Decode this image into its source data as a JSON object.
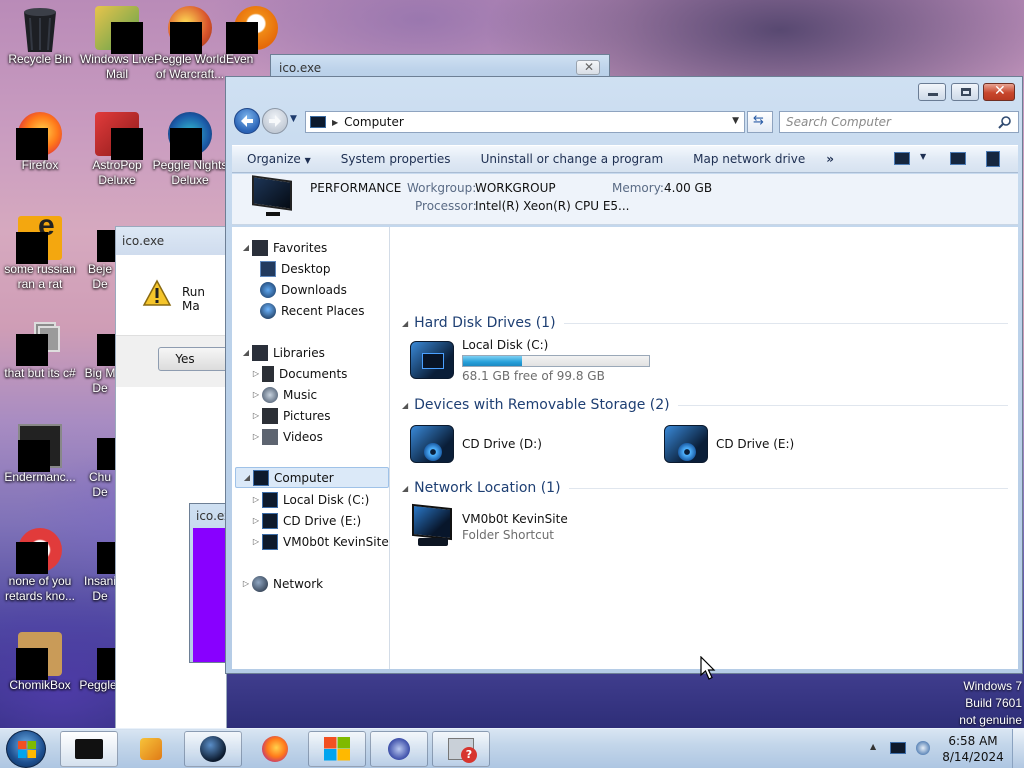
{
  "desktop": {
    "icons": [
      {
        "label": "Recycle Bin"
      },
      {
        "label": "Windows Live Mail"
      },
      {
        "label": "Peggle World of Warcraft..."
      },
      {
        "label": "Even"
      },
      {
        "label": "Firefox"
      },
      {
        "label": "AstroPop Deluxe"
      },
      {
        "label": "Peggle Nights Deluxe"
      },
      {
        "label": "some russian ran a rat"
      },
      {
        "label": "Beje De"
      },
      {
        "label": "that but its c#"
      },
      {
        "label": "Big M De"
      },
      {
        "label": "Endermanc..."
      },
      {
        "label": "Chu De"
      },
      {
        "label": "none of you retards kno..."
      },
      {
        "label": "Insani De"
      },
      {
        "label": "ChomikBox"
      },
      {
        "label": "Peggle"
      }
    ],
    "watermark": {
      "line1": "Windows 7",
      "line2": "Build 7601",
      "line3": "not genuine"
    }
  },
  "dialog_back": {
    "title": "ico.exe"
  },
  "dialog_run": {
    "title": "ico.exe",
    "message": "Run Ma",
    "yes_label": "Yes"
  },
  "dialog_purple": {
    "title": "ico.ex",
    "color": "#8800ff"
  },
  "explorer": {
    "address": {
      "path": "Computer"
    },
    "search": {
      "placeholder": "Search Computer"
    },
    "commands": {
      "organize": "Organize",
      "system_properties": "System properties",
      "uninstall": "Uninstall or change a program",
      "map_drive": "Map network drive",
      "more": "»"
    },
    "details": {
      "name": "PERFORMANCE",
      "workgroup_label": "Workgroup:",
      "workgroup_value": "WORKGROUP",
      "memory_label": "Memory:",
      "memory_value": "4.00 GB",
      "processor_label": "Processor:",
      "processor_value": "Intel(R) Xeon(R) CPU E5..."
    },
    "nav": {
      "favorites": "Favorites",
      "desktop": "Desktop",
      "downloads": "Downloads",
      "recent_places": "Recent Places",
      "libraries": "Libraries",
      "documents": "Documents",
      "music": "Music",
      "pictures": "Pictures",
      "videos": "Videos",
      "computer": "Computer",
      "local_disk": "Local Disk (C:)",
      "cd_drive_e": "CD Drive (E:)",
      "kevinsite": "VM0b0t KevinSite",
      "network": "Network"
    },
    "groups": {
      "hdd": "Hard Disk Drives (1)",
      "removable": "Devices with Removable Storage (2)",
      "network": "Network Location (1)"
    },
    "items": {
      "local_disk": {
        "name": "Local Disk (C:)",
        "free_text": "68.1 GB free of 99.8 GB",
        "used_fraction": 0.318
      },
      "cd_d": {
        "name": "CD Drive (D:)"
      },
      "cd_e": {
        "name": "CD Drive (E:)"
      },
      "kevinsite": {
        "name": "VM0b0t KevinSite",
        "type": "Folder Shortcut"
      }
    },
    "colors": {
      "progress": "#26a0da",
      "title_bar": "#bcd2ea",
      "close_button": "#c8462c"
    }
  },
  "taskbar": {
    "clock": {
      "time": "6:58 AM",
      "date": "8/14/2024"
    }
  }
}
